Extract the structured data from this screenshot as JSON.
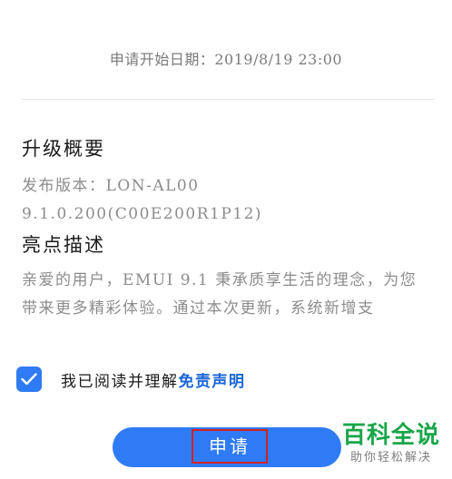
{
  "apply_date": "申请开始日期：2019/8/19 23:00",
  "overview": {
    "title": "升级概要",
    "version": "发布版本：LON-AL00 9.1.0.200(C00E200R1P12)"
  },
  "highlights": {
    "title": "亮点描述",
    "text": "亲爱的用户，EMUI 9.1 秉承质享生活的理念，为您带来更多精彩体验。通过本次更新，系统新增支"
  },
  "agreement": {
    "checked": true,
    "prefix": "我已阅读并理解",
    "link": "免责声明"
  },
  "submit_label": "申请",
  "watermark": {
    "main": "百科全说",
    "sub": "助你轻松解决"
  },
  "colors": {
    "accent": "#2f7bf5",
    "link": "#1a66d8",
    "highlight_box": "#d42020",
    "watermark": "#1aa64a"
  },
  "icons": {
    "checkbox": "checkmark-icon"
  }
}
